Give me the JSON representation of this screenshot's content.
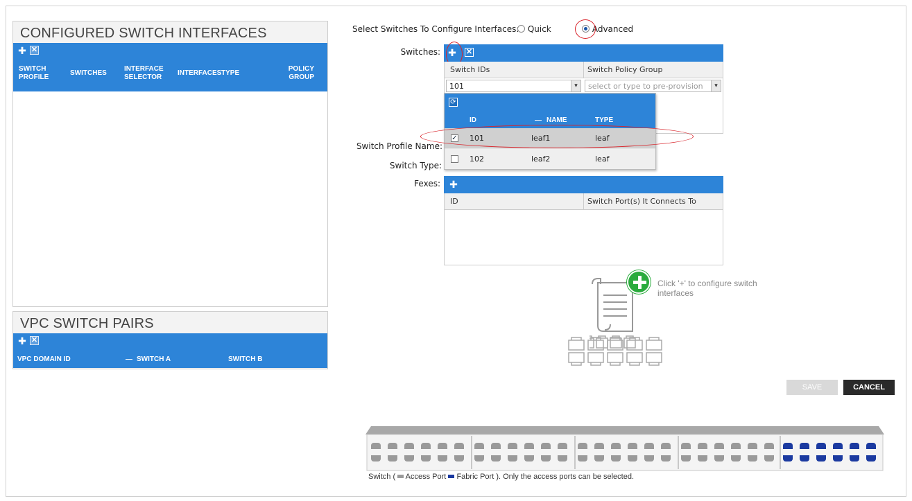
{
  "left_panel": {
    "configured": {
      "title": "CONFIGURED SWITCH INTERFACES",
      "columns": [
        "SWITCH\nPROFILE",
        "SWITCHES",
        "INTERFACE\nSELECTOR",
        "INTERFACES",
        "TYPE",
        "POLICY\nGROUP"
      ]
    },
    "vpc": {
      "title": "VPC SWITCH PAIRS",
      "columns": [
        "VPC DOMAIN ID",
        "SWITCH A",
        "SWITCH B"
      ],
      "sort_mark": "—"
    },
    "toolbar": {
      "add_glyph": "✚",
      "delete_glyph": "✕"
    }
  },
  "form": {
    "select_label": "Select Switches To Configure Interfaces:",
    "quick_label": "Quick",
    "advanced_label": "Advanced",
    "mode": "advanced",
    "switches_label": "Switches:",
    "switch_profile_name_label": "Switch Profile Name:",
    "switch_type_label": "Switch Type:",
    "fexes_label": "Fexes:"
  },
  "switches_grid": {
    "col_ids": "Switch IDs",
    "col_policy": "Switch Policy Group",
    "id_value": "101",
    "policy_placeholder": "select or type to pre-provision",
    "dropdown": {
      "col_id": "ID",
      "col_name": "NAME",
      "col_type": "TYPE",
      "sort_mark": "—",
      "rows": [
        {
          "id": "101",
          "name": "leaf1",
          "type": "leaf",
          "checked": true
        },
        {
          "id": "102",
          "name": "leaf2",
          "type": "leaf",
          "checked": false
        }
      ]
    }
  },
  "fexes_grid": {
    "col_id": "ID",
    "col_port": "Switch Port(s) It Connects To"
  },
  "hint": {
    "text": "Click '+' to configure switch interfaces"
  },
  "buttons": {
    "save": "SAVE",
    "cancel": "CANCEL"
  },
  "switch_diagram": {
    "caption_prefix": "Switch (",
    "access_label": "Access Port",
    "fabric_label": "Fabric Port",
    "caption_suffix": "). Only the access ports can be selected."
  },
  "colors": {
    "accent_blue": "#2d84d8",
    "fabric_port": "#1b3aa0",
    "access_port": "#9a9a9a",
    "highlight": "#d8232a",
    "add_green": "#2aab3d"
  }
}
